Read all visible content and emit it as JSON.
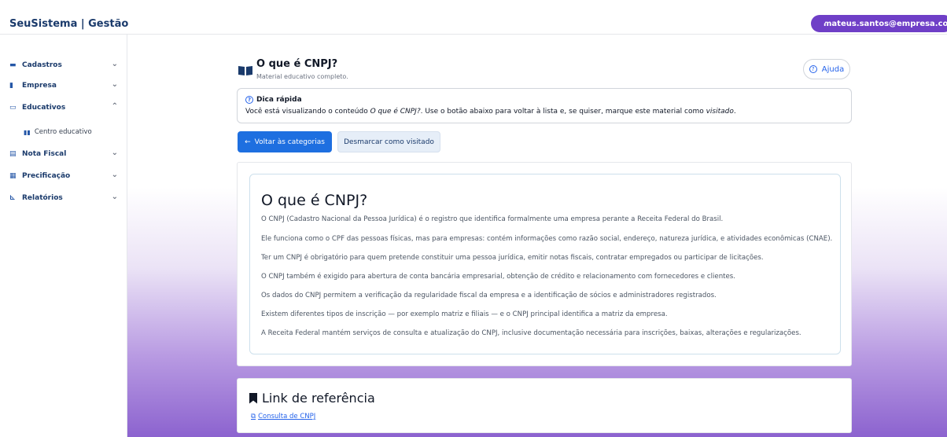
{
  "app": {
    "brand": "SeuSistema | Gestão",
    "user_email": "mateus.santos@empresa.com"
  },
  "sidebar": {
    "items": [
      {
        "label": "Cadastros",
        "icon": "folder-icon",
        "chevron": "⌄"
      },
      {
        "label": "Empresa",
        "icon": "building-icon",
        "chevron": "⌄"
      },
      {
        "label": "Educativos",
        "icon": "chalkboard-icon",
        "chevron": "⌃"
      },
      {
        "label": "Nota Fiscal",
        "icon": "receipt-icon",
        "chevron": "⌄"
      },
      {
        "label": "Precificação",
        "icon": "calculator-icon",
        "chevron": "⌄"
      },
      {
        "label": "Relatórios",
        "icon": "chart-icon",
        "chevron": "⌄"
      }
    ],
    "subitems": [
      {
        "label": "Centro educativo",
        "icon": "book-icon"
      }
    ]
  },
  "header": {
    "title": "O que é CNPJ?",
    "subtitle": "Material educativo completo.",
    "help_label": "Ajuda"
  },
  "tip": {
    "title": "Dica rápida",
    "text_part1": "Você está visualizando o conteúdo ",
    "text_em1": "O que é CNPJ?",
    "text_part2": ". Use o botão abaixo para voltar à lista e, se quiser, marque este material como ",
    "text_em2": "visitado",
    "text_part3": "."
  },
  "actions": {
    "back_label": "Voltar às categorias",
    "unmark_label": "Desmarcar como visitado"
  },
  "article": {
    "title": "O que é CNPJ?",
    "paragraphs": [
      "O CNPJ (Cadastro Nacional da Pessoa Jurídica) é o registro que identifica formalmente uma empresa perante a Receita Federal do Brasil.",
      "Ele funciona como o CPF das pessoas físicas, mas para empresas: contém informações como razão social, endereço, natureza jurídica, e atividades econômicas (CNAE).",
      "Ter um CNPJ é obrigatório para quem pretende constituir uma pessoa jurídica, emitir notas fiscais, contratar empregados ou participar de licitações.",
      "O CNPJ também é exigido para abertura de conta bancária empresarial, obtenção de crédito e relacionamento com fornecedores e clientes.",
      "Os dados do CNPJ permitem a verificação da regularidade fiscal da empresa e a identificação de sócios e administradores registrados.",
      "Existem diferentes tipos de inscrição — por exemplo matriz e filiais — e o CNPJ principal identifica a matriz da empresa.",
      "A Receita Federal mantém serviços de consulta e atualização do CNPJ, inclusive documentação necessária para inscrições, baixas, alterações e regularizações."
    ]
  },
  "reference": {
    "title": "Link de referência",
    "link_label": "Consulta de CNPJ"
  },
  "colors": {
    "primary": "#1e6fe0",
    "accent_purple": "#6f3fc7",
    "brand_text": "#1a3a6b"
  }
}
